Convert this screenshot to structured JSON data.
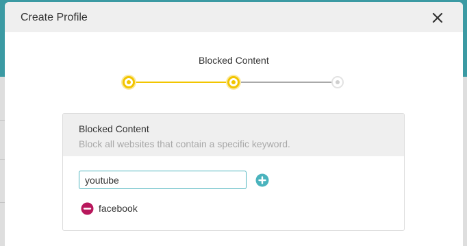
{
  "dialog": {
    "title": "Create Profile",
    "close_icon": "close-icon"
  },
  "stepper": {
    "current_step_label": "Blocked Content",
    "steps_total": 3,
    "steps_completed": 2,
    "active_color": "#f2c500",
    "inactive_color": "#a9a9a9"
  },
  "blocked_content": {
    "title": "Blocked Content",
    "description": "Block all websites that contain a specific keyword.",
    "input_value": "youtube",
    "add_icon": "plus-circle-icon",
    "remove_icon": "minus-circle-icon",
    "keywords": [
      "facebook"
    ]
  },
  "colors": {
    "accent": "#4ab3bd",
    "remove": "#b8175c",
    "header_bg": "#3b9aa3"
  }
}
